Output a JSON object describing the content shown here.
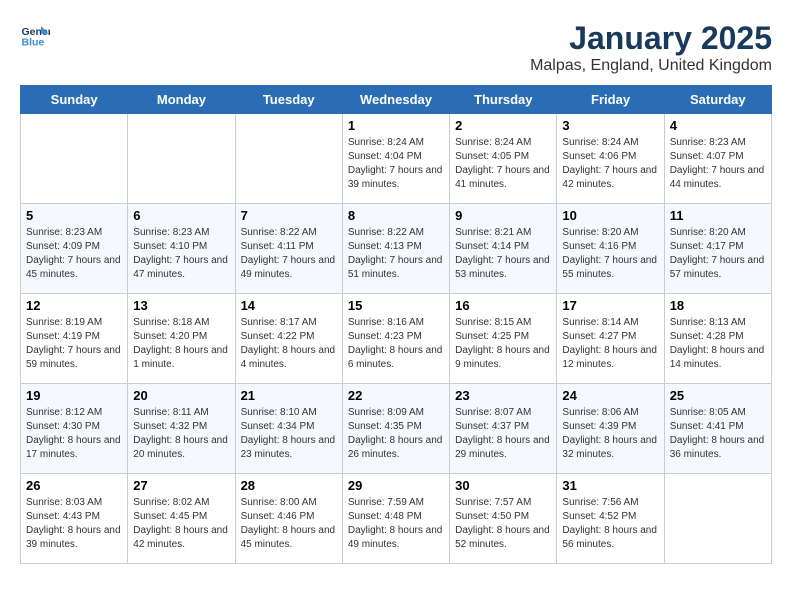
{
  "logo": {
    "line1": "General",
    "line2": "Blue"
  },
  "title": "January 2025",
  "subtitle": "Malpas, England, United Kingdom",
  "weekdays": [
    "Sunday",
    "Monday",
    "Tuesday",
    "Wednesday",
    "Thursday",
    "Friday",
    "Saturday"
  ],
  "weeks": [
    [
      {
        "day": "",
        "sunrise": "",
        "sunset": "",
        "daylight": ""
      },
      {
        "day": "",
        "sunrise": "",
        "sunset": "",
        "daylight": ""
      },
      {
        "day": "",
        "sunrise": "",
        "sunset": "",
        "daylight": ""
      },
      {
        "day": "1",
        "sunrise": "Sunrise: 8:24 AM",
        "sunset": "Sunset: 4:04 PM",
        "daylight": "Daylight: 7 hours and 39 minutes."
      },
      {
        "day": "2",
        "sunrise": "Sunrise: 8:24 AM",
        "sunset": "Sunset: 4:05 PM",
        "daylight": "Daylight: 7 hours and 41 minutes."
      },
      {
        "day": "3",
        "sunrise": "Sunrise: 8:24 AM",
        "sunset": "Sunset: 4:06 PM",
        "daylight": "Daylight: 7 hours and 42 minutes."
      },
      {
        "day": "4",
        "sunrise": "Sunrise: 8:23 AM",
        "sunset": "Sunset: 4:07 PM",
        "daylight": "Daylight: 7 hours and 44 minutes."
      }
    ],
    [
      {
        "day": "5",
        "sunrise": "Sunrise: 8:23 AM",
        "sunset": "Sunset: 4:09 PM",
        "daylight": "Daylight: 7 hours and 45 minutes."
      },
      {
        "day": "6",
        "sunrise": "Sunrise: 8:23 AM",
        "sunset": "Sunset: 4:10 PM",
        "daylight": "Daylight: 7 hours and 47 minutes."
      },
      {
        "day": "7",
        "sunrise": "Sunrise: 8:22 AM",
        "sunset": "Sunset: 4:11 PM",
        "daylight": "Daylight: 7 hours and 49 minutes."
      },
      {
        "day": "8",
        "sunrise": "Sunrise: 8:22 AM",
        "sunset": "Sunset: 4:13 PM",
        "daylight": "Daylight: 7 hours and 51 minutes."
      },
      {
        "day": "9",
        "sunrise": "Sunrise: 8:21 AM",
        "sunset": "Sunset: 4:14 PM",
        "daylight": "Daylight: 7 hours and 53 minutes."
      },
      {
        "day": "10",
        "sunrise": "Sunrise: 8:20 AM",
        "sunset": "Sunset: 4:16 PM",
        "daylight": "Daylight: 7 hours and 55 minutes."
      },
      {
        "day": "11",
        "sunrise": "Sunrise: 8:20 AM",
        "sunset": "Sunset: 4:17 PM",
        "daylight": "Daylight: 7 hours and 57 minutes."
      }
    ],
    [
      {
        "day": "12",
        "sunrise": "Sunrise: 8:19 AM",
        "sunset": "Sunset: 4:19 PM",
        "daylight": "Daylight: 7 hours and 59 minutes."
      },
      {
        "day": "13",
        "sunrise": "Sunrise: 8:18 AM",
        "sunset": "Sunset: 4:20 PM",
        "daylight": "Daylight: 8 hours and 1 minute."
      },
      {
        "day": "14",
        "sunrise": "Sunrise: 8:17 AM",
        "sunset": "Sunset: 4:22 PM",
        "daylight": "Daylight: 8 hours and 4 minutes."
      },
      {
        "day": "15",
        "sunrise": "Sunrise: 8:16 AM",
        "sunset": "Sunset: 4:23 PM",
        "daylight": "Daylight: 8 hours and 6 minutes."
      },
      {
        "day": "16",
        "sunrise": "Sunrise: 8:15 AM",
        "sunset": "Sunset: 4:25 PM",
        "daylight": "Daylight: 8 hours and 9 minutes."
      },
      {
        "day": "17",
        "sunrise": "Sunrise: 8:14 AM",
        "sunset": "Sunset: 4:27 PM",
        "daylight": "Daylight: 8 hours and 12 minutes."
      },
      {
        "day": "18",
        "sunrise": "Sunrise: 8:13 AM",
        "sunset": "Sunset: 4:28 PM",
        "daylight": "Daylight: 8 hours and 14 minutes."
      }
    ],
    [
      {
        "day": "19",
        "sunrise": "Sunrise: 8:12 AM",
        "sunset": "Sunset: 4:30 PM",
        "daylight": "Daylight: 8 hours and 17 minutes."
      },
      {
        "day": "20",
        "sunrise": "Sunrise: 8:11 AM",
        "sunset": "Sunset: 4:32 PM",
        "daylight": "Daylight: 8 hours and 20 minutes."
      },
      {
        "day": "21",
        "sunrise": "Sunrise: 8:10 AM",
        "sunset": "Sunset: 4:34 PM",
        "daylight": "Daylight: 8 hours and 23 minutes."
      },
      {
        "day": "22",
        "sunrise": "Sunrise: 8:09 AM",
        "sunset": "Sunset: 4:35 PM",
        "daylight": "Daylight: 8 hours and 26 minutes."
      },
      {
        "day": "23",
        "sunrise": "Sunrise: 8:07 AM",
        "sunset": "Sunset: 4:37 PM",
        "daylight": "Daylight: 8 hours and 29 minutes."
      },
      {
        "day": "24",
        "sunrise": "Sunrise: 8:06 AM",
        "sunset": "Sunset: 4:39 PM",
        "daylight": "Daylight: 8 hours and 32 minutes."
      },
      {
        "day": "25",
        "sunrise": "Sunrise: 8:05 AM",
        "sunset": "Sunset: 4:41 PM",
        "daylight": "Daylight: 8 hours and 36 minutes."
      }
    ],
    [
      {
        "day": "26",
        "sunrise": "Sunrise: 8:03 AM",
        "sunset": "Sunset: 4:43 PM",
        "daylight": "Daylight: 8 hours and 39 minutes."
      },
      {
        "day": "27",
        "sunrise": "Sunrise: 8:02 AM",
        "sunset": "Sunset: 4:45 PM",
        "daylight": "Daylight: 8 hours and 42 minutes."
      },
      {
        "day": "28",
        "sunrise": "Sunrise: 8:00 AM",
        "sunset": "Sunset: 4:46 PM",
        "daylight": "Daylight: 8 hours and 45 minutes."
      },
      {
        "day": "29",
        "sunrise": "Sunrise: 7:59 AM",
        "sunset": "Sunset: 4:48 PM",
        "daylight": "Daylight: 8 hours and 49 minutes."
      },
      {
        "day": "30",
        "sunrise": "Sunrise: 7:57 AM",
        "sunset": "Sunset: 4:50 PM",
        "daylight": "Daylight: 8 hours and 52 minutes."
      },
      {
        "day": "31",
        "sunrise": "Sunrise: 7:56 AM",
        "sunset": "Sunset: 4:52 PM",
        "daylight": "Daylight: 8 hours and 56 minutes."
      },
      {
        "day": "",
        "sunrise": "",
        "sunset": "",
        "daylight": ""
      }
    ]
  ]
}
